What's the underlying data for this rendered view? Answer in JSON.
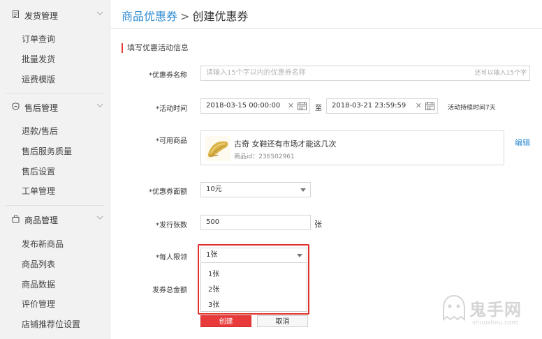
{
  "sidebar": {
    "groups": [
      {
        "title": "发货管理",
        "icon": "document-icon",
        "items": [
          "订单查询",
          "批量发货",
          "运费模版"
        ]
      },
      {
        "title": "售后管理",
        "icon": "shield-icon",
        "items": [
          "退款/售后",
          "售后服务质量",
          "售后设置",
          "工单管理"
        ]
      },
      {
        "title": "商品管理",
        "icon": "bag-icon",
        "items": [
          "发布新商品",
          "商品列表",
          "商品数据",
          "评价管理",
          "店铺推荐位设置"
        ]
      }
    ]
  },
  "breadcrumb": {
    "parent": "商品优惠券",
    "sep": ">",
    "current": "创建优惠券"
  },
  "section_title": "填写优惠活动信息",
  "form": {
    "coupon_name": {
      "label": "*优惠券名称",
      "placeholder": "请输入15个字以内的优惠券名称",
      "hint": "还可以输入15个字"
    },
    "time": {
      "label": "*活动时间",
      "start": "2018-03-15 00:00:00",
      "to": "至",
      "end": "2018-03-21 23:59:59",
      "note": "活动持续时间7天"
    },
    "product": {
      "label": "*可用商品",
      "name": "古奇 女鞋还有市场才能这几次",
      "id": "商品id：236502961",
      "edit": "编辑"
    },
    "amount": {
      "label": "*优惠券面额",
      "value": "10元"
    },
    "count": {
      "label": "*发行张数",
      "value": "500",
      "unit": "张"
    },
    "limit": {
      "label": "*每人限领",
      "value": "1张",
      "options": [
        "1张",
        "2张",
        "3张"
      ]
    },
    "total": {
      "label": "发券总金额"
    }
  },
  "buttons": {
    "create": "创建",
    "cancel": "取消"
  },
  "watermark": {
    "text": "鬼手网",
    "sub": "shuoshou.com"
  },
  "colors": {
    "accent": "#2f8bd2",
    "danger": "#e83a3a",
    "highlight": "#e0302b"
  }
}
